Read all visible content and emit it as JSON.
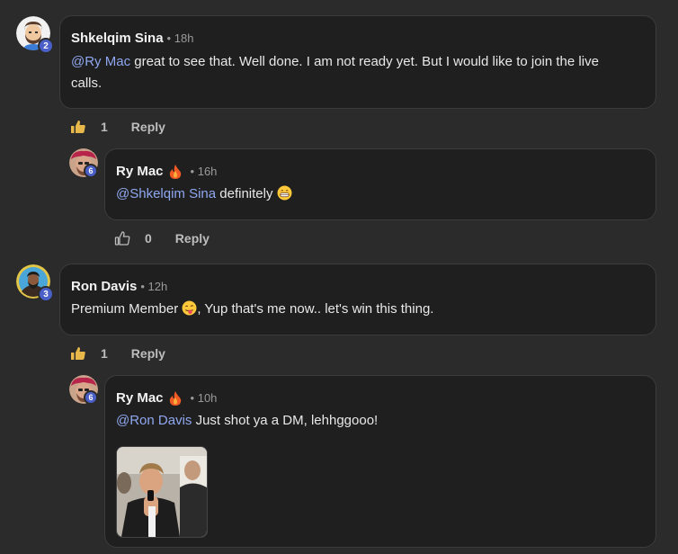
{
  "comments": [
    {
      "author": "Shkelqim Sina",
      "time": "18h",
      "level": "2",
      "mention": "@Ry Mac",
      "text_line1": " great to see that. Well done. I am not ready yet. But I would like to join the live",
      "text_line2": "calls.",
      "likes": "1",
      "reply_label": "Reply",
      "reply": {
        "author": "Ry Mac",
        "time": "16h",
        "level": "6",
        "mention": "@Shkelqim Sina",
        "text": " definitely",
        "likes": "0",
        "reply_label": "Reply"
      }
    },
    {
      "author": "Ron Davis",
      "time": "12h",
      "level": "3",
      "text_before_emoji": "Premium Member ",
      "text_after_emoji": ", Yup that's me now.. let's win this thing.",
      "likes": "1",
      "reply_label": "Reply",
      "reply": {
        "author": "Ry Mac",
        "time": "10h",
        "level": "6",
        "mention": "@Ron Davis",
        "text": " Just shot ya a DM, lehhggooo!",
        "attachment": "gif-image"
      }
    }
  ],
  "separator": "•",
  "colors": {
    "background": "#2b2b2b",
    "bubble": "#1f1f1f",
    "mention": "#8fa7f0",
    "level_badge": "#4a5fc8",
    "like_active": "#e8b84a"
  }
}
